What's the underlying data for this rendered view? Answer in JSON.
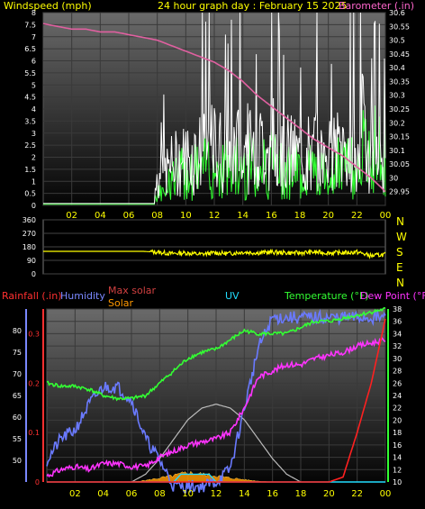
{
  "header": {
    "wind_label": "Windspeed (mph)",
    "title": "24 hour graph day : February 15 2025",
    "baro_label": "Barometer (.in)"
  },
  "labels": {
    "rainfall": "Rainfall (.in)",
    "humidity": "Humidity",
    "max_solar": "Max solar",
    "solar": "Solar",
    "uv": "UV",
    "temperature": "Temperature (°F)",
    "dew_point": "Dew Point (°F)",
    "compass": [
      "N",
      "W",
      "S",
      "E",
      "N"
    ]
  },
  "colors": {
    "background": "#000000",
    "panel_bg_top": "#6a6a6a",
    "panel_bg_bottom": "#050505",
    "wind_avg": "#ffffff",
    "wind_gust": "#33ff33",
    "barometer": "#e060a0",
    "direction": "#ffff00",
    "temperature": "#33ff33",
    "dew_point": "#ff33ff",
    "humidity": "#6a7aff",
    "rainfall": "#ff2020",
    "max_solar": "#bbbbbb",
    "solar": "#ff9900",
    "uv": "#22ddff",
    "x_tick_text": "#ffff00",
    "top_label_yellow": "#ffff00",
    "baro_label_color": "#ff66cc"
  },
  "chart_data": [
    {
      "type": "line",
      "title": "24 hour graph day : February 15 2025",
      "x_ticks": [
        "02",
        "04",
        "06",
        "08",
        "10",
        "12",
        "14",
        "16",
        "18",
        "20",
        "22",
        "00"
      ],
      "x_hours": [
        2,
        4,
        6,
        8,
        10,
        12,
        14,
        16,
        18,
        20,
        22,
        24
      ],
      "xlim": [
        0,
        24
      ],
      "grid": true,
      "y_left": {
        "label": "Windspeed (mph)",
        "range": [
          0,
          8
        ],
        "ticks": [
          "0",
          "0.5",
          "1",
          "1.5",
          "2",
          "2.5",
          "3",
          "3.5",
          "4",
          "4.5",
          "5",
          "5.5",
          "6",
          "6.5",
          "7",
          "7.5",
          "8"
        ]
      },
      "y_right": {
        "label": "Barometer (.in)",
        "range": [
          29.9,
          30.6
        ],
        "ticks": [
          "29.95",
          "30",
          "30.05",
          "30.1",
          "30.15",
          "30.2",
          "30.25",
          "30.3",
          "30.35",
          "30.4",
          "30.45",
          "30.5",
          "30.55",
          "30.6"
        ]
      },
      "series": [
        {
          "name": "Windspeed (mph)",
          "axis": "left",
          "x": [
            0,
            7,
            7.8,
            8.2,
            9,
            10,
            11,
            12,
            13,
            14,
            15,
            16,
            17,
            18,
            19,
            20,
            21,
            22,
            22.5,
            23,
            23.5,
            24
          ],
          "y": [
            0.1,
            0.1,
            0.5,
            1.0,
            1.5,
            1.8,
            2.0,
            2.2,
            2.0,
            2.3,
            2.0,
            2.5,
            2.0,
            1.8,
            2.0,
            1.8,
            2.2,
            2.0,
            3.0,
            2.0,
            1.5,
            1.0
          ]
        },
        {
          "name": "Barometer (.in)",
          "axis": "right",
          "x": [
            0,
            1,
            2,
            3,
            4,
            5,
            6,
            7,
            8,
            9,
            10,
            11,
            12,
            13,
            14,
            15,
            16,
            17,
            18,
            19,
            20,
            21,
            22,
            23,
            24
          ],
          "y": [
            30.56,
            30.55,
            30.54,
            30.54,
            30.53,
            30.53,
            30.52,
            30.51,
            30.5,
            30.48,
            30.46,
            30.44,
            30.42,
            30.39,
            30.35,
            30.3,
            30.26,
            30.22,
            30.18,
            30.14,
            30.11,
            30.08,
            30.04,
            30.0,
            29.95
          ]
        }
      ]
    },
    {
      "type": "line",
      "x_ticks": [],
      "xlim": [
        0,
        24
      ],
      "y": {
        "range": [
          0,
          360
        ],
        "ticks": [
          "0",
          "90",
          "180",
          "270",
          "360"
        ]
      },
      "series": [
        {
          "name": "Wind direction",
          "x": [
            0,
            2,
            4,
            6,
            7,
            8,
            9,
            10,
            11,
            12,
            13,
            14,
            15,
            16,
            17,
            18,
            19,
            20,
            21,
            22,
            23,
            24
          ],
          "y": [
            150,
            150,
            150,
            150,
            150,
            145,
            135,
            140,
            130,
            140,
            135,
            145,
            140,
            145,
            140,
            140,
            145,
            140,
            140,
            145,
            120,
            130
          ]
        }
      ]
    },
    {
      "type": "line",
      "x_ticks": [
        "02",
        "04",
        "06",
        "08",
        "10",
        "12",
        "14",
        "16",
        "18",
        "20",
        "22",
        "00"
      ],
      "x_hours": [
        2,
        4,
        6,
        8,
        10,
        12,
        14,
        16,
        18,
        20,
        22,
        24
      ],
      "xlim": [
        0,
        24
      ],
      "grid": true,
      "y_humidity": {
        "label": "Humidity",
        "range": [
          45,
          85
        ],
        "ticks": [
          "50",
          "55",
          "60",
          "65",
          "70",
          "75",
          "80"
        ]
      },
      "y_rain": {
        "label": "Rainfall (.in)",
        "range": [
          0,
          0.35
        ],
        "ticks": [
          "0",
          "0.1",
          "0.2",
          "0.3"
        ]
      },
      "y_temp": {
        "label": "Temperature (°F)",
        "range": [
          10,
          38
        ],
        "ticks": [
          "10",
          "12",
          "14",
          "16",
          "18",
          "20",
          "22",
          "24",
          "26",
          "28",
          "30",
          "32",
          "34",
          "36",
          "38"
        ]
      },
      "series": [
        {
          "name": "Temperature (°F)",
          "axis": "temp",
          "x": [
            0,
            1,
            2,
            3,
            4,
            5,
            6,
            7,
            8,
            9,
            10,
            11,
            12,
            13,
            14,
            15,
            16,
            17,
            18,
            19,
            20,
            21,
            22,
            23,
            24
          ],
          "y": [
            26,
            25.5,
            25.5,
            25,
            24,
            23.5,
            23.5,
            24,
            26,
            28,
            30,
            31,
            31.5,
            33,
            34.5,
            34,
            34,
            34,
            35,
            36,
            36,
            36.5,
            37,
            37.5,
            38
          ]
        },
        {
          "name": "Dew Point (°F)",
          "axis": "temp",
          "x": [
            0,
            1,
            2,
            3,
            4,
            5,
            6,
            7,
            8,
            9,
            10,
            11,
            12,
            13,
            14,
            15,
            16,
            17,
            18,
            19,
            20,
            21,
            22,
            23,
            24
          ],
          "y": [
            11,
            12,
            12.5,
            12,
            13,
            13,
            12.5,
            12.5,
            14,
            15,
            16,
            16.5,
            17,
            18,
            22,
            27,
            28,
            29,
            29,
            30,
            30.5,
            31,
            32,
            32.5,
            33
          ]
        },
        {
          "name": "Humidity",
          "axis": "humidity",
          "x": [
            0,
            1,
            2,
            3,
            4,
            5,
            6,
            7,
            8,
            9,
            10,
            11,
            12,
            13,
            14,
            15,
            16,
            17,
            18,
            19,
            20,
            21,
            22,
            23,
            24
          ],
          "y": [
            50,
            55,
            57,
            63,
            67,
            67,
            64,
            55,
            50,
            44,
            44,
            44,
            45,
            48,
            62,
            76,
            83,
            83,
            83,
            83,
            83,
            83,
            83,
            83,
            83
          ]
        },
        {
          "name": "Rainfall (.in)",
          "axis": "rain",
          "x": [
            0,
            20,
            21,
            22,
            23,
            24
          ],
          "y": [
            0,
            0,
            0.01,
            0.1,
            0.2,
            0.33
          ]
        },
        {
          "name": "Max solar",
          "axis": "solar",
          "x": [
            6,
            7,
            8,
            9,
            10,
            11,
            12,
            13,
            14,
            15,
            16,
            17,
            18
          ],
          "y": [
            0,
            0.1,
            0.3,
            0.55,
            0.8,
            0.95,
            1.0,
            0.95,
            0.8,
            0.55,
            0.3,
            0.1,
            0
          ]
        },
        {
          "name": "Solar",
          "axis": "solar",
          "x": [
            6,
            7,
            8,
            9,
            10,
            11,
            12,
            13,
            14,
            15,
            16,
            17
          ],
          "y": [
            0,
            0.02,
            0.05,
            0.08,
            0.12,
            0.1,
            0.08,
            0.05,
            0.03,
            0.01,
            0,
            0
          ]
        },
        {
          "name": "UV",
          "axis": "solar",
          "x": [
            0,
            9,
            9.5,
            11.5,
            12,
            24
          ],
          "y": [
            0,
            0,
            0.1,
            0.1,
            0,
            0
          ]
        }
      ]
    }
  ]
}
